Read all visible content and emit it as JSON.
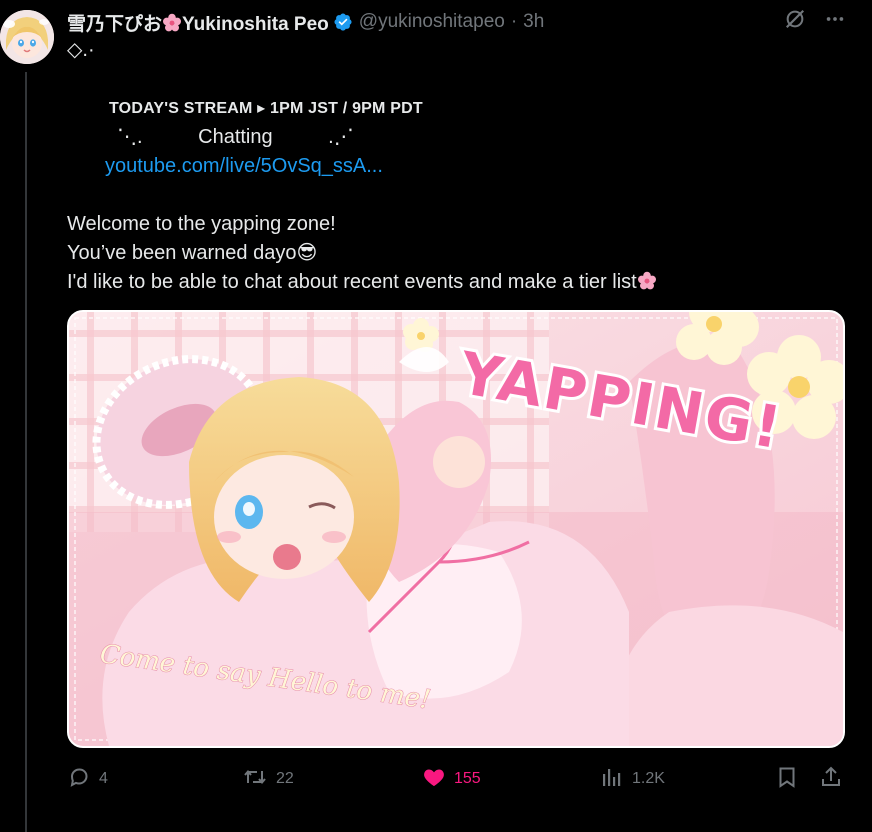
{
  "tweet": {
    "author": {
      "name": "雪乃下ぴお",
      "name_suffix": "Yukinoshita Peo",
      "handle": "@yukinoshitapeo",
      "verified": true
    },
    "separator": "·",
    "time": "3h",
    "body": {
      "line1": "◇.·",
      "line2": "",
      "stream_line": "TODAY'S STREAM ▸ 1PM JST / 9PM PDT",
      "chatting_line": "⋱.          Chatting          .⋰",
      "link": "youtube.com/live/5OvSq_ssA...",
      "line6": "",
      "line7": "Welcome to the yapping zone!",
      "line8": "You’ve been warned dayo😎",
      "line9": "I'd like to be able to chat about recent events and make a tier list"
    },
    "media": {
      "headline": "YAPPING!",
      "caption": "Come to say Hello to me!",
      "alt_description": ""
    },
    "stats": {
      "replies": "4",
      "reposts": "22",
      "likes": "155",
      "views": "1.2K"
    },
    "colors": {
      "background": "#000000",
      "text": "#e7e9ea",
      "muted": "#71767b",
      "link": "#1d9bf0",
      "like": "#f91880",
      "verified": "#1d9bf0"
    },
    "icons": [
      "grok-icon",
      "more-icon",
      "reply-icon",
      "repost-icon",
      "heart-icon",
      "views-icon",
      "bookmark-icon",
      "share-icon",
      "verified-icon",
      "sakura-icon"
    ]
  }
}
